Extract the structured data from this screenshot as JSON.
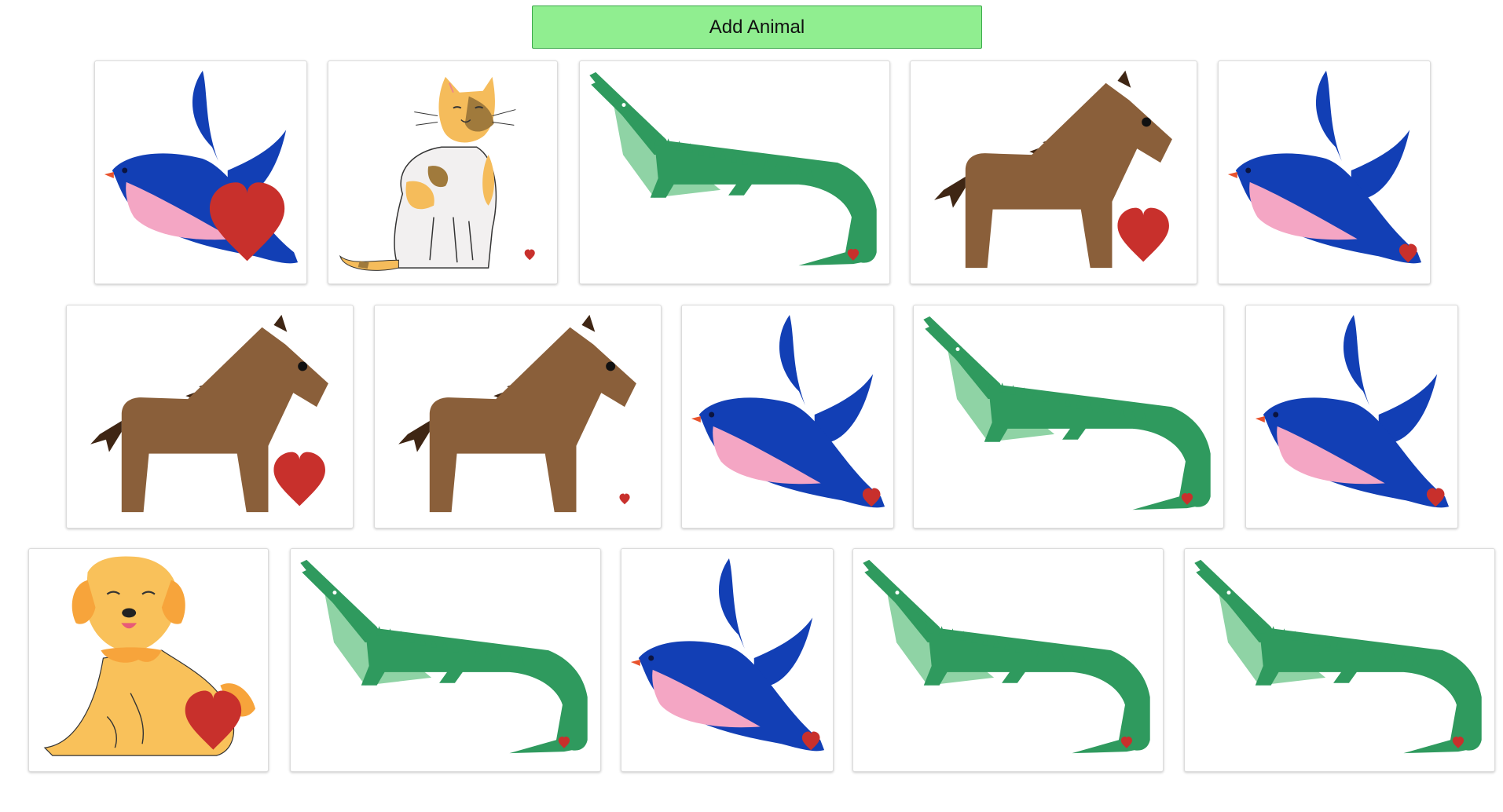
{
  "toolbar": {
    "add_label": "Add Animal"
  },
  "colors": {
    "button_bg": "#90ee90",
    "bird_blue": "#123fb5",
    "bird_belly": "#f4a6c4",
    "croc_dark": "#2f9a5e",
    "croc_light": "#8fd3a5",
    "horse_brown": "#8a5f3a",
    "horse_mane": "#3f2614",
    "cat_orange": "#f5bc5b",
    "dog_gold": "#f9c15a",
    "heart_red": "#c8302c"
  },
  "animals": [
    {
      "kind": "bird",
      "icon": "bird-icon",
      "heart": "large"
    },
    {
      "kind": "cat",
      "icon": "cat-icon",
      "heart": "small"
    },
    {
      "kind": "crocodile",
      "icon": "crocodile-icon",
      "heart": "small"
    },
    {
      "kind": "horse",
      "icon": "horse-icon",
      "heart": "large"
    },
    {
      "kind": "bird",
      "icon": "bird-icon",
      "heart": "small"
    },
    {
      "kind": "horse",
      "icon": "horse-icon",
      "heart": "large"
    },
    {
      "kind": "horse",
      "icon": "horse-icon",
      "heart": "small"
    },
    {
      "kind": "bird",
      "icon": "bird-icon",
      "heart": "small"
    },
    {
      "kind": "crocodile",
      "icon": "crocodile-icon",
      "heart": "small"
    },
    {
      "kind": "bird",
      "icon": "bird-icon",
      "heart": "small"
    },
    {
      "kind": "dog",
      "icon": "dog-icon",
      "heart": "large"
    },
    {
      "kind": "crocodile",
      "icon": "crocodile-icon",
      "heart": "small"
    },
    {
      "kind": "bird",
      "icon": "bird-icon",
      "heart": "small"
    },
    {
      "kind": "crocodile",
      "icon": "crocodile-icon",
      "heart": "small"
    },
    {
      "kind": "crocodile",
      "icon": "crocodile-icon",
      "heart": "small"
    }
  ]
}
